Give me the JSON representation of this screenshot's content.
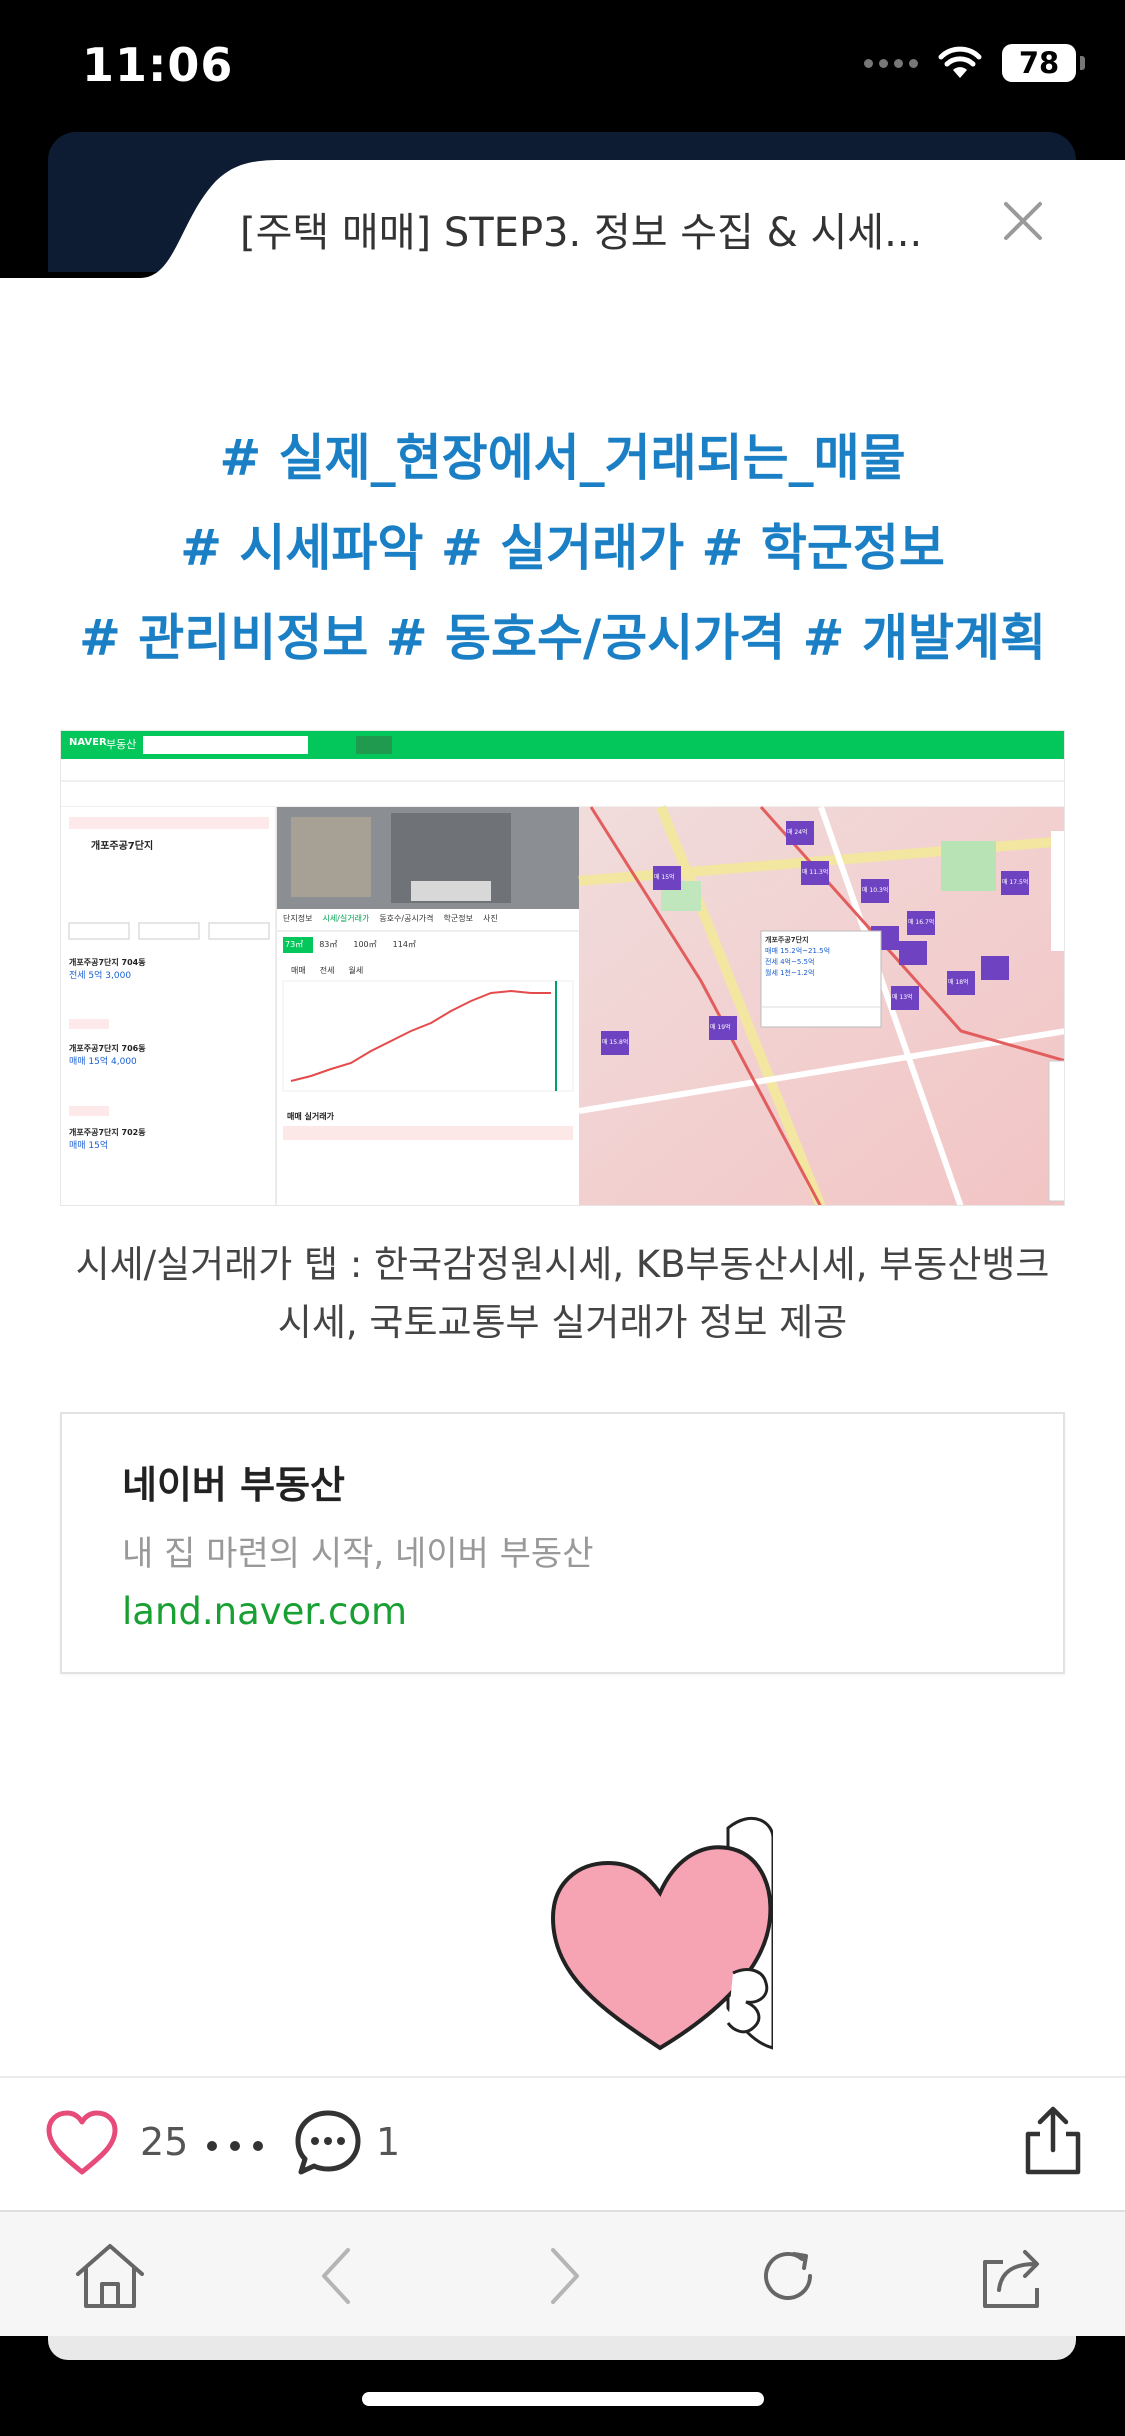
{
  "status_bar": {
    "time": "11:06",
    "battery": "78"
  },
  "header": {
    "title": "[주택 매매] STEP3. 정보 수집 & 시세..."
  },
  "post": {
    "tags": [
      "# 실제_현장에서_거래되는_매물",
      "# 시세파악 # 실거래가 # 학군정보",
      "# 관리비정보 # 동호수/공시가격 # 개발계획"
    ],
    "image_caption_line1": "시세/실거래가 탭 : 한국감정원시세, KB부동산시세, 부동산뱅크",
    "image_caption_line2": "시세, 국토교통부 실거래가 정보 제공",
    "link_card": {
      "title": "네이버 부동산",
      "description": "내 집 마련의 시작, 네이버 부동산",
      "url": "land.naver.com"
    }
  },
  "screenshot": {
    "logo": "NAVER",
    "service": "부동산",
    "complex_name": "개포주공7단지",
    "tabs": [
      "단지정보",
      "시세/실거래가",
      "동호수/공시가격",
      "학군정보",
      "사진"
    ],
    "sizes": [
      "73㎡",
      "83㎡",
      "100㎡",
      "114㎡"
    ],
    "sub_tabs": [
      "매매",
      "전세",
      "월세"
    ],
    "trade_title": "매매 실거래가",
    "listings": [
      {
        "name": "개포주공7단지 704동",
        "price": "전세 5억 3,000"
      },
      {
        "name": "개포주공7단지 706동",
        "price": "매매 15억 4,000"
      },
      {
        "name": "개포주공7단지 702동",
        "price": "매매 15억"
      }
    ],
    "map_popup": {
      "name": "개포주공7단지",
      "line1": "매매 15.2억~21.5억",
      "line2": "전세 4억~5.5억",
      "line3": "월세 1천~1.2억"
    },
    "map_markers": [
      "매 24억",
      "매 11.3억",
      "매 15억",
      "매 10.3억",
      "매 16.7억",
      "매 17.5억",
      "매 12억",
      "매 18억",
      "매 19억",
      "매 15.8억",
      "매 13억"
    ]
  },
  "actions": {
    "like_count": "25",
    "comment_count": "1"
  },
  "colors": {
    "tag_blue": "#1a7fc4",
    "naver_green": "#03c75a",
    "link_green": "#19a033",
    "heart_pink": "#e64b7a"
  }
}
